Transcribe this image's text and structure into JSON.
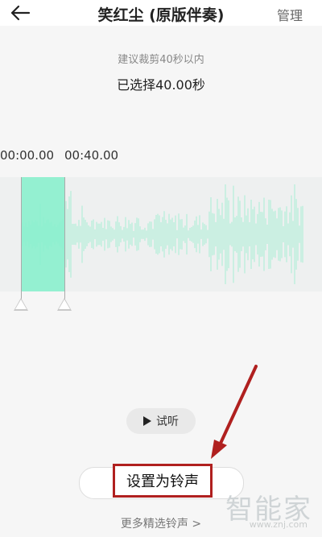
{
  "header": {
    "title": "笑红尘 (原版伴奏)",
    "manage_label": "管理"
  },
  "info": {
    "hint": "建议裁剪40秒以内",
    "selected": "已选择40.00秒"
  },
  "timeline": {
    "start_time": "00:00.00",
    "end_time": "00:40.00"
  },
  "actions": {
    "audition_label": "试听",
    "set_ringtone_label": "设置为铃声",
    "more_label": "更多精选铃声 >"
  },
  "watermark": {
    "text": "智能家",
    "url": "www.znj.com"
  },
  "colors": {
    "selection": "#89f0cd",
    "waveform": "#a8eed4",
    "annotation": "#b0201f"
  },
  "icons": {
    "back": "arrow-left-icon",
    "play": "play-icon"
  }
}
